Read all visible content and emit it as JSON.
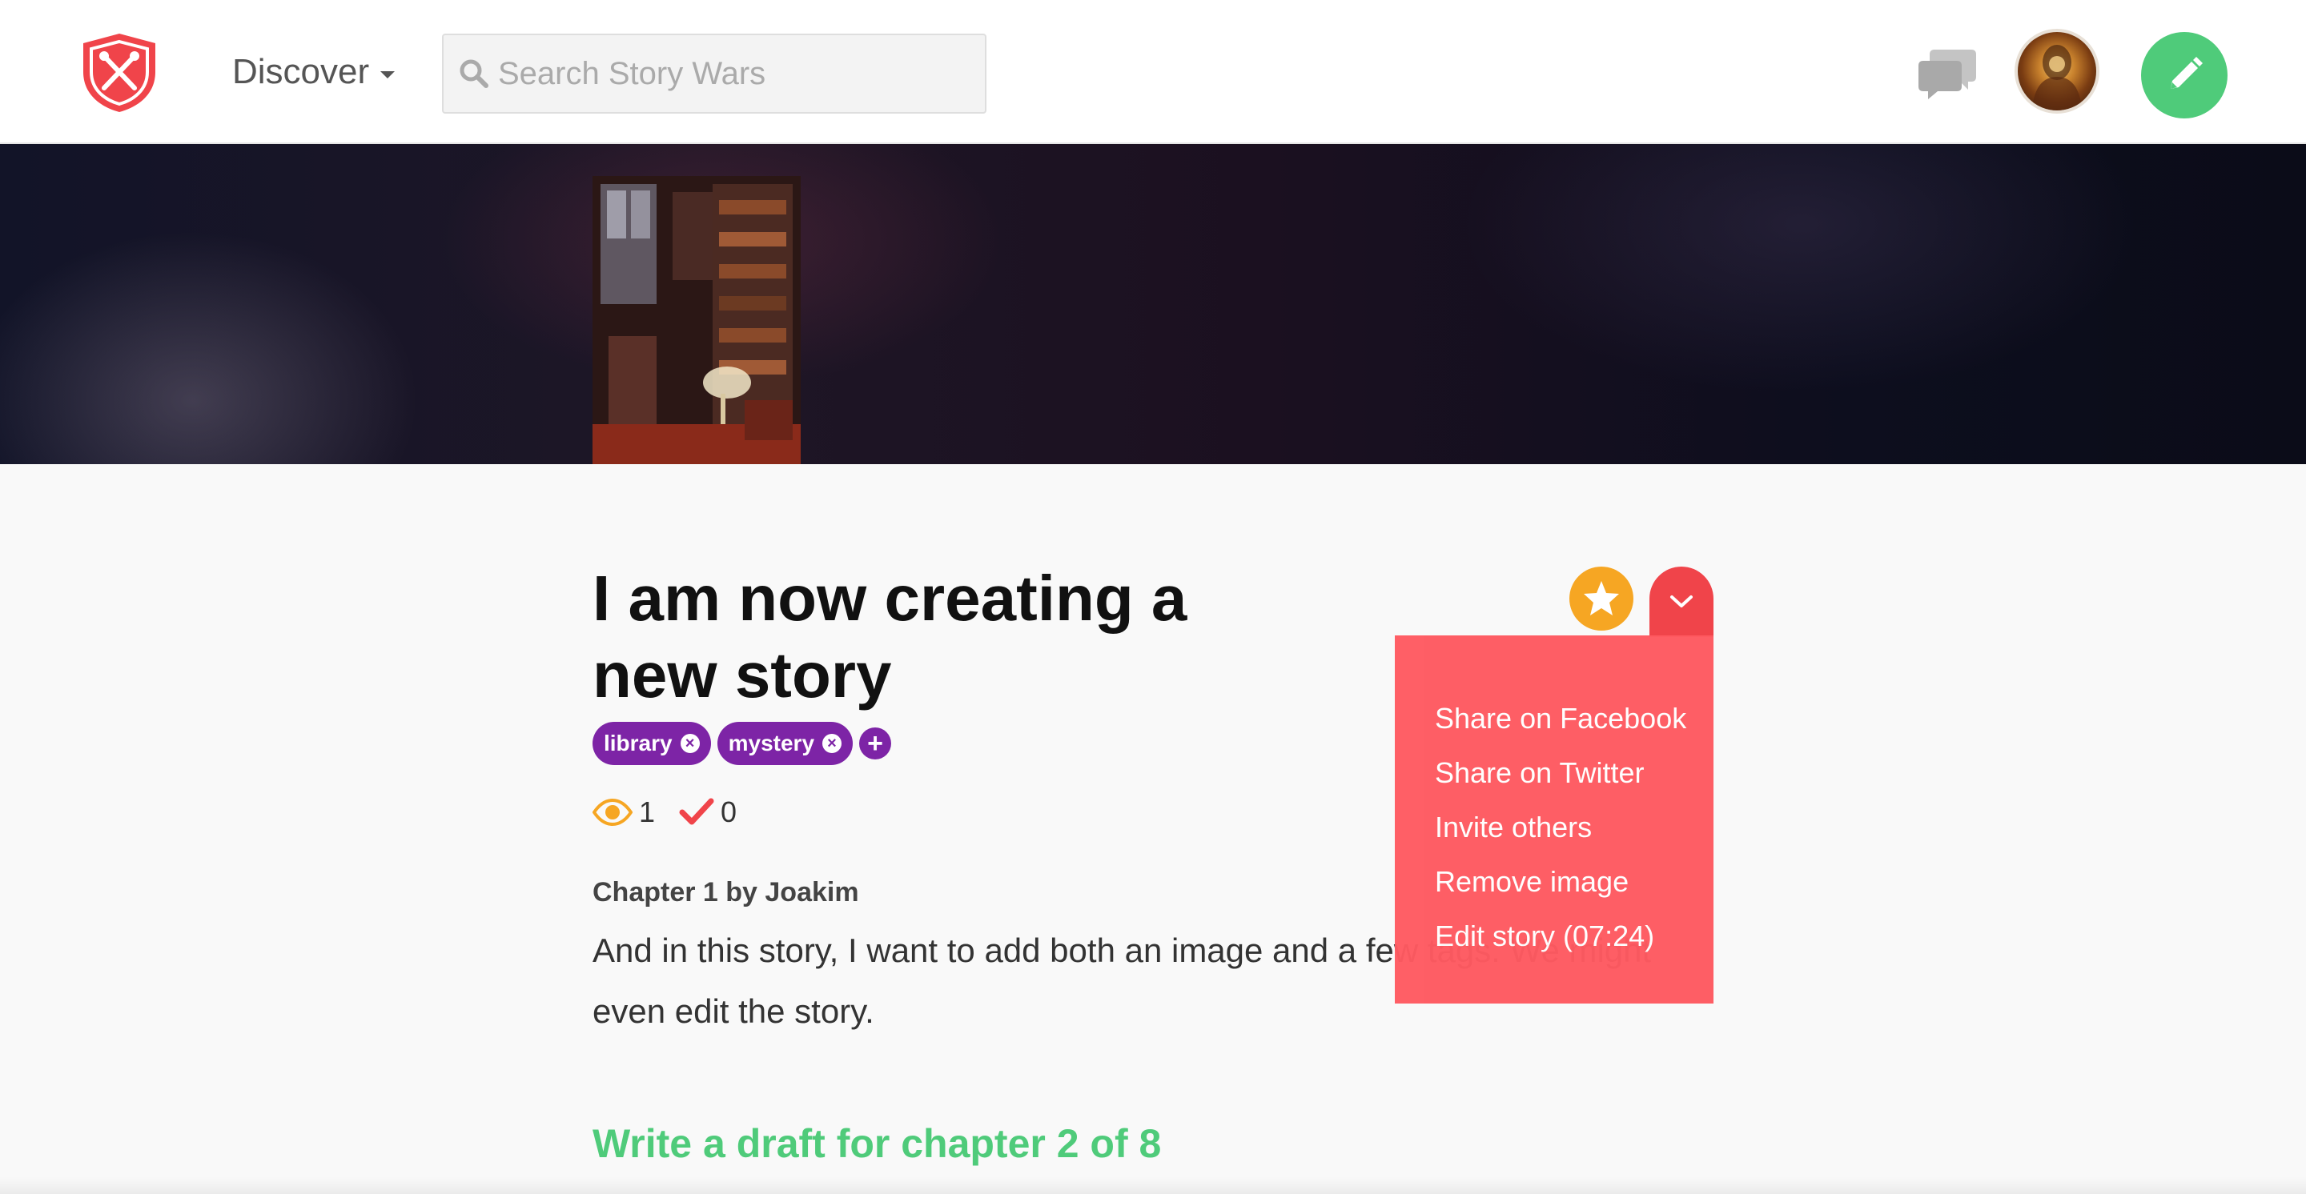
{
  "header": {
    "nav_label": "Discover",
    "search_placeholder": "Search Story Wars"
  },
  "story": {
    "title": "I am now creating a new story",
    "tags": [
      "library",
      "mystery"
    ],
    "views": "1",
    "votes": "0",
    "chapter_label": "Chapter 1 by Joakim",
    "chapter_text": "And in this story, I want to add both an image and a few tags. We might even edit the story.",
    "draft_link": "Write a draft for chapter 2 of 8"
  },
  "menu": {
    "items": [
      "Share on Facebook",
      "Share on Twitter",
      "Invite others",
      "Remove image",
      "Edit story (07:24)"
    ]
  },
  "colors": {
    "brand_red": "#f0444a",
    "menu_bg": "#ff5a61",
    "tag_purple": "#7d24a6",
    "accent_green": "#4fcb7a",
    "star_orange": "#f6a623"
  },
  "icons": [
    "shield-logo-icon",
    "chevron-down-icon",
    "search-icon",
    "chat-bubbles-icon",
    "pencil-icon",
    "star-icon",
    "eye-icon",
    "checkmark-icon",
    "close-icon",
    "plus-icon"
  ]
}
